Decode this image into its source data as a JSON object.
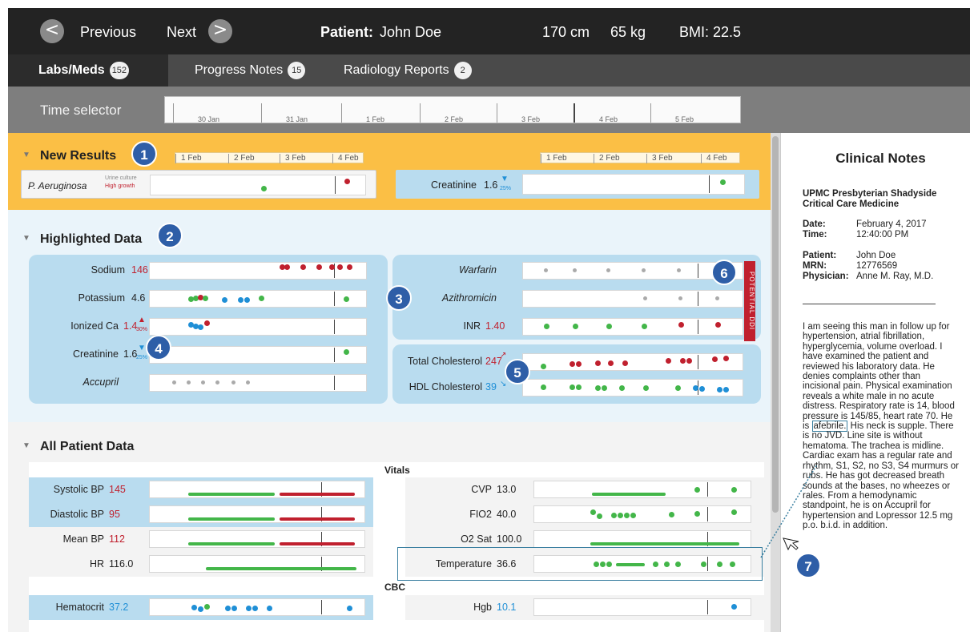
{
  "nav": {
    "prev_icon": "<",
    "prev_label": "Previous",
    "next_label": "Next",
    "next_icon": ">",
    "patient_prefix": "Patient:",
    "patient_name": "John Doe",
    "height": "170 cm",
    "weight": "65 kg",
    "bmi": "BMI: 22.5"
  },
  "tabs": [
    {
      "label": "Labs/Meds",
      "count": "152"
    },
    {
      "label": "Progress Notes",
      "count": "15"
    },
    {
      "label": "Radiology Reports",
      "count": "2"
    }
  ],
  "time_selector": {
    "label": "Time selector",
    "ticks": [
      "30 Jan",
      "31 Jan",
      "1 Feb",
      "2 Feb",
      "3 Feb",
      "4 Feb",
      "5 Feb"
    ]
  },
  "new_results": {
    "title": "New Results",
    "marker": "1",
    "axis": [
      "1 Feb",
      "2 Feb",
      "3 Feb",
      "4 Feb"
    ],
    "items": [
      {
        "name": "P. Aeruginosa",
        "note1": "Urine culture",
        "note2": "High growth"
      },
      {
        "name": "Creatinine",
        "value": "1.6",
        "change": "25%"
      }
    ]
  },
  "highlighted": {
    "title": "Highlighted Data",
    "marker": "2",
    "markers": [
      "3",
      "4",
      "5",
      "6"
    ],
    "potential": "POTENTIAL DDI",
    "left": [
      {
        "name": "Sodium",
        "value": "146"
      },
      {
        "name": "Potassium",
        "value": "4.6"
      },
      {
        "name": "Ionized Ca",
        "value": "1.4",
        "change": "30%"
      },
      {
        "name": "Creatinine",
        "value": "1.6",
        "change": "25%"
      },
      {
        "name": "Accupril",
        "value": ""
      }
    ],
    "right": [
      {
        "name": "Warfarin",
        "value": ""
      },
      {
        "name": "Azithromicin",
        "value": ""
      },
      {
        "name": "INR",
        "value": "1.40"
      },
      {
        "name": "Total Cholesterol",
        "value": "247"
      },
      {
        "name": "HDL Cholesterol",
        "value": "39"
      }
    ]
  },
  "all_data": {
    "title": "All Patient Data",
    "vitals_header": "Vitals",
    "cbc_header": "CBC",
    "left": [
      {
        "name": "Systolic BP",
        "value": "145"
      },
      {
        "name": "Diastolic BP",
        "value": "95"
      },
      {
        "name": "Mean BP",
        "value": "112"
      },
      {
        "name": "HR",
        "value": "116.0"
      },
      {
        "name": "Hematocrit",
        "value": "37.2"
      }
    ],
    "right": [
      {
        "name": "CVP",
        "value": "13.0"
      },
      {
        "name": "FIO2",
        "value": "40.0"
      },
      {
        "name": "O2 Sat",
        "value": "100.0"
      },
      {
        "name": "Temperature",
        "value": "36.6"
      },
      {
        "name": "Hgb",
        "value": "10.1"
      }
    ]
  },
  "notes": {
    "title": "Clinical Notes",
    "hospital_1": "UPMC Presbyterian Shadyside",
    "hospital_2": "Critical Care Medicine",
    "date_label": "Date:",
    "date": "February 4, 2017",
    "time_label": "Time:",
    "time": "12:40:00 PM",
    "patient_label": "Patient:",
    "patient": "John Doe",
    "mrn_label": "MRN:",
    "mrn": "12776569",
    "physician_label": "Physician:",
    "physician": "Anne M. Ray, M.D.",
    "body_1": "I am seeing this man in follow up for hypertension, atrial fibrillation, hyperglycemia, volume overload. I have examined the patient and reviewed his laboratory data. He denies complaints other than incisional pain. Physical examination reveals a white male in no acute distress. Respiratory rate is 14, blood pressure is 145/85, heart rate 70. He is",
    "highlight": "afebrile.",
    "body_2": "His neck is supple. There is no JVD. Line site is without hematoma. The trachea is midline. Cardiac exam has a regular rate and rhythm, S1, S2, no S3, S4 murmurs or rubs. He has got decreased breath sounds at the bases, no wheezes or rales. From a hemodynamic standpoint, he is on Accupril for hypertension and Lopressor 12.5 mg p.o. b.i.d. in addition.",
    "marker": "7"
  },
  "colors": {
    "accent_orange": "#fbbf45",
    "light_blue": "#b9dcef",
    "abnormal_red": "#c0202e",
    "normal_green": "#43b649",
    "low_blue": "#1f8fd6",
    "marker_blue": "#2e5ea7"
  }
}
